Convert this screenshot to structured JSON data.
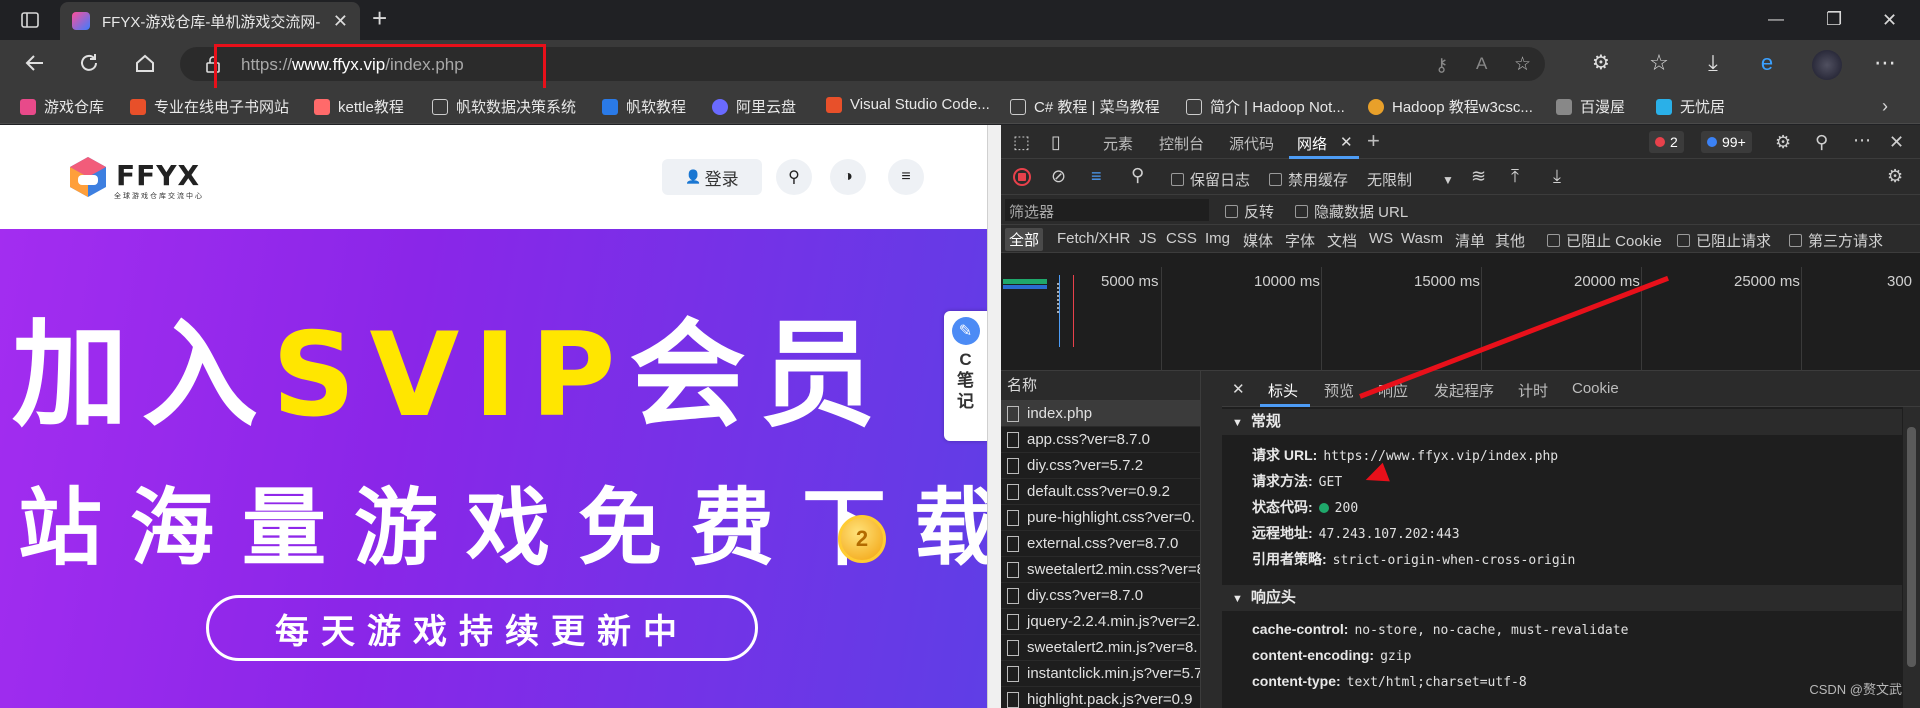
{
  "window": {
    "tab_title": "FFYX-游戏仓库-单机游戏交流网-",
    "new_tab": "+",
    "min": "—",
    "max": "❐",
    "close": "✕"
  },
  "address": {
    "prefix": "https://",
    "domain": "www.ffyx.vip",
    "path": "/index.php"
  },
  "bookmarks": [
    {
      "label": "游戏仓库",
      "color": "#e84a8a"
    },
    {
      "label": "专业在线电子书网站",
      "color": "#e8502a"
    },
    {
      "label": "kettle教程",
      "color": "#ff6a6a"
    },
    {
      "label": "帆软数据决策系统",
      "color": "#cccccc"
    },
    {
      "label": "帆软教程",
      "color": "#2a7ae8"
    },
    {
      "label": "阿里云盘",
      "color": "#6a6aff"
    },
    {
      "label": "Visual Studio Code...",
      "color": "#e8502a"
    },
    {
      "label": "C# 教程 | 菜鸟教程",
      "color": "#cccccc"
    },
    {
      "label": "简介 | Hadoop Not...",
      "color": "#cccccc"
    },
    {
      "label": "Hadoop 教程w3csc...",
      "color": "#e8a02a"
    },
    {
      "label": "百漫屋",
      "color": "#888888"
    },
    {
      "label": "无忧居",
      "color": "#2ab0e8"
    }
  ],
  "site": {
    "logo": "FFYX",
    "logo_sub": "全球游戏仓库交流中心",
    "login": "登录",
    "banner_line1_a": "加入",
    "banner_line1_b": "SVIP",
    "banner_line1_c": "会员",
    "banner_line2": "站海量游戏免费下载",
    "pill_text": "每天游戏持续更新中",
    "coin": "2",
    "note_label": "C笔记"
  },
  "devtools": {
    "tabs": [
      "元素",
      "控制台",
      "源代码",
      "网络"
    ],
    "active_tab": "网络",
    "errors": "2",
    "messages": "99+",
    "toolbar": {
      "preserve_log": "保留日志",
      "disable_cache": "禁用缓存",
      "throttle": "无限制"
    },
    "filter_placeholder": "筛选器",
    "invert": "反转",
    "hide_data": "隐藏数据 URL",
    "types": [
      "全部",
      "Fetch/XHR",
      "JS",
      "CSS",
      "Img",
      "媒体",
      "字体",
      "文档",
      "WS",
      "Wasm",
      "清单",
      "其他"
    ],
    "blocked_cookie": "已阻止 Cookie",
    "blocked_req": "已阻止请求",
    "third_party": "第三方请求",
    "timeline_labels": [
      "5000 ms",
      "10000 ms",
      "15000 ms",
      "20000 ms",
      "25000 ms",
      "300"
    ],
    "name_header": "名称",
    "requests": [
      "index.php",
      "app.css?ver=8.7.0",
      "diy.css?ver=5.7.2",
      "default.css?ver=0.9.2",
      "pure-highlight.css?ver=0.",
      "external.css?ver=8.7.0",
      "sweetalert2.min.css?ver=8",
      "diy.css?ver=8.7.0",
      "jquery-2.2.4.min.js?ver=2.",
      "sweetalert2.min.js?ver=8.",
      "instantclick.min.js?ver=5.7",
      "highlight.pack.js?ver=0.9"
    ],
    "detail_close": "✕",
    "detail_tabs": [
      "标头",
      "预览",
      "响应",
      "发起程序",
      "计时",
      "Cookie"
    ],
    "general_title": "常规",
    "general": {
      "url_k": "请求 URL:",
      "url_v": "https://www.ffyx.vip/index.php",
      "method_k": "请求方法:",
      "method_v": "GET",
      "status_k": "状态代码:",
      "status_v": "200",
      "remote_k": "远程地址:",
      "remote_v": "47.243.107.202:443",
      "referrer_k": "引用者策略:",
      "referrer_v": "strict-origin-when-cross-origin"
    },
    "resp_title": "响应头",
    "resp": {
      "cc_k": "cache-control:",
      "cc_v": "no-store, no-cache, must-revalidate",
      "ce_k": "content-encoding:",
      "ce_v": "gzip",
      "ct_k": "content-type:",
      "ct_v": "text/html;charset=utf-8"
    },
    "watermark": "CSDN @赘文武"
  },
  "colors": {
    "annotation_red": "#e8101a",
    "banner_purple": "#8a26e8",
    "banner_yellow": "#ffe600",
    "devtools_accent": "#4d9cf5"
  }
}
